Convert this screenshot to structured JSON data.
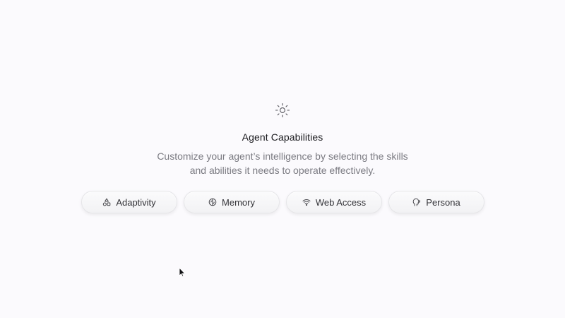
{
  "header": {
    "icon": "sun-sparkle-icon",
    "title": "Agent Capabilities",
    "subtitle_line1": "Customize your agent’s intelligence by selecting the skills",
    "subtitle_line2": "and abilities it needs to operate effectively."
  },
  "capabilities": [
    {
      "label": "Adaptivity",
      "icon": "shapes-icon"
    },
    {
      "label": "Memory",
      "icon": "brain-icon"
    },
    {
      "label": "Web Access",
      "icon": "wifi-icon"
    },
    {
      "label": "Persona",
      "icon": "speaking-head-icon"
    }
  ],
  "colors": {
    "background": "#fbfafd",
    "title": "#1b1b1f",
    "subtitle": "#7b7b82",
    "chip_text": "#333338"
  }
}
